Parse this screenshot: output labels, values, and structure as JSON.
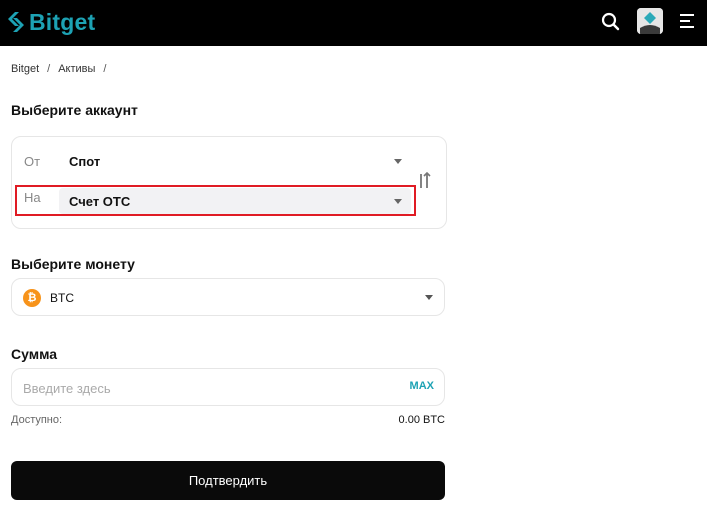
{
  "header": {
    "logo_text": "Bitget",
    "brand_color": "#1da2b4",
    "icons": [
      "search-icon",
      "avatar",
      "menu-icon"
    ]
  },
  "breadcrumb": {
    "items": [
      "Bitget",
      "Активы"
    ],
    "separator": "/"
  },
  "account_section": {
    "title": "Выберите аккаунт",
    "from_label": "От",
    "from_value": "Спот",
    "to_label": "На",
    "to_value": "Счет OTC",
    "highlight_color": "#e01b24"
  },
  "coin_section": {
    "title": "Выберите монету",
    "coin_symbol": "₿",
    "coin_label": "BTC"
  },
  "amount_section": {
    "title": "Сумма",
    "placeholder": "Введите здесь",
    "value": "",
    "max_label": "MAX",
    "available_label": "Доступно:",
    "available_value": "0.00 BTC"
  },
  "confirm_button": {
    "label": "Подтвердить"
  }
}
